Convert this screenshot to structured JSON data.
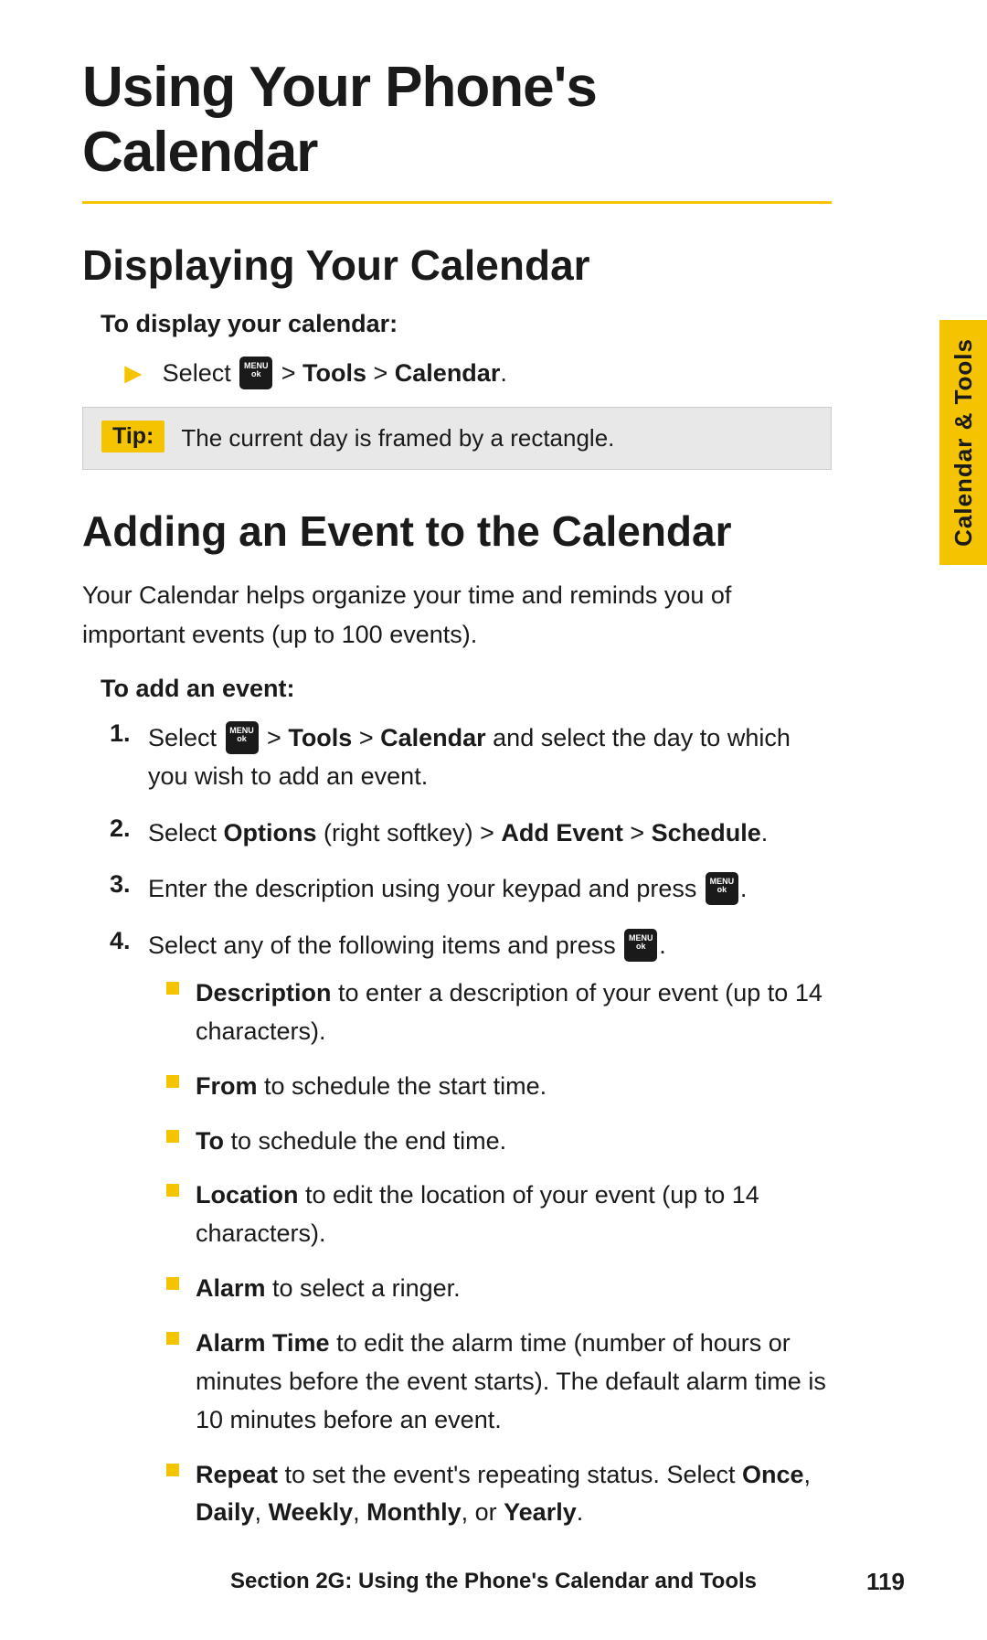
{
  "page": {
    "title": "Using Your Phone's Calendar",
    "sidebar_tab": "Calendar & Tools"
  },
  "section1": {
    "heading": "Displaying Your Calendar",
    "subsection_label": "To display your calendar:",
    "instruction": {
      "text_before": "Select",
      "icon": "MENU\nok",
      "text_after": "> Tools > Calendar."
    },
    "tip": {
      "label": "Tip:",
      "text": "The current day is framed by a rectangle."
    }
  },
  "section2": {
    "heading": "Adding an Event to the Calendar",
    "body_text": "Your Calendar helps organize your time and reminds you of important events (up to 100 events).",
    "subsection_label": "To add an event:",
    "steps": [
      {
        "num": "1.",
        "text_before": "Select",
        "icon": "MENU\nok",
        "text_after": "> Tools > Calendar and select the day to which you wish to add an event."
      },
      {
        "num": "2.",
        "text": "Select Options (right softkey) > Add Event > Schedule."
      },
      {
        "num": "3.",
        "text_before": "Enter the description using your keypad and press",
        "icon": "MENU\nok",
        "text_after": "."
      },
      {
        "num": "4.",
        "text_before": "Select any of the following items and press",
        "icon": "MENU\nok",
        "text_after": "."
      }
    ],
    "bullets": [
      {
        "bold_part": "Description",
        "rest": " to enter a description of your event (up to 14 characters)."
      },
      {
        "bold_part": "From",
        "rest": " to schedule the start time."
      },
      {
        "bold_part": "To",
        "rest": " to schedule the end time."
      },
      {
        "bold_part": "Location",
        "rest": " to edit the location of your event (up to 14 characters)."
      },
      {
        "bold_part": "Alarm",
        "rest": " to select a ringer."
      },
      {
        "bold_part": "Alarm Time",
        "rest": " to edit the alarm time (number of hours or minutes before the event starts). The default alarm time is 10 minutes before an event."
      },
      {
        "bold_part": "Repeat",
        "rest": " to set the event's repeating status. Select Once, Daily, Weekly, Monthly, or Yearly."
      }
    ]
  },
  "footer": {
    "text": "Section 2G: Using the Phone's Calendar and Tools",
    "page": "119"
  }
}
